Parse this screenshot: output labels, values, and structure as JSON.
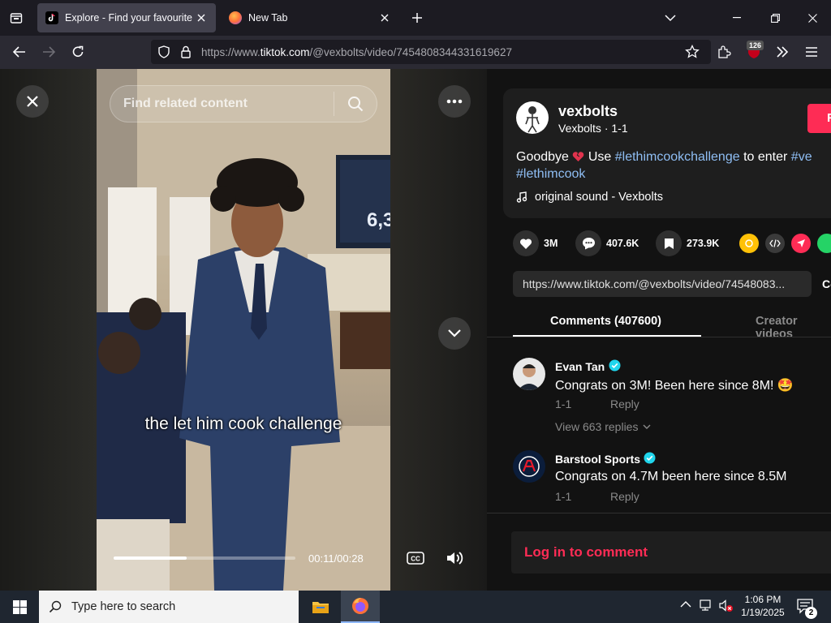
{
  "browser": {
    "tabs": [
      {
        "title": "Explore - Find your favourite vid"
      },
      {
        "title": "New Tab"
      }
    ],
    "url_prefix": "https://www.",
    "url_domain": "tiktok.com",
    "url_path": "/@vexbolts/video/7454808344331619627",
    "extension_badge": "126"
  },
  "video": {
    "search_placeholder": "Find related content",
    "tv_text": "6,3",
    "caption": "the let him cook challenge",
    "time": "00:11/00:28",
    "progress": 0.4,
    "cc_label": "CC"
  },
  "post": {
    "username": "vexbolts",
    "display_line": "Vexbolts · 1-1",
    "follow_label": "F",
    "desc_start": "Goodbye",
    "desc_use": "Use",
    "desc_tag1": "#lethimcookchallenge",
    "desc_mid": "to enter",
    "desc_tag2": "#ve",
    "desc_tag3": "#lethimcook",
    "sound": "original sound - Vexbolts",
    "likes": "3M",
    "comments": "407.6K",
    "saves": "273.9K",
    "link": "https://www.tiktok.com/@vexbolts/video/74548083...",
    "copy_label": "Co"
  },
  "tabs": {
    "comments": "Comments (407600)",
    "creator": "Creator videos"
  },
  "comments": [
    {
      "name": "Evan Tan",
      "text": "Congrats on 3M! Been here since 8M! 🤩",
      "date": "1-1",
      "reply": "Reply",
      "view_replies": "View 663 replies"
    },
    {
      "name": "Barstool Sports",
      "text": "Congrats on 4.7M been here since 8.5M",
      "date": "1-1",
      "reply": "Reply"
    }
  ],
  "login_label": "Log in to comment",
  "taskbar": {
    "search_placeholder": "Type here to search",
    "time": "1:06 PM",
    "date": "1/19/2025",
    "notif_count": "2"
  },
  "colors": {
    "accent": "#fe2c55",
    "hashtag": "#8fbef4",
    "verified": "#20d5ec"
  }
}
